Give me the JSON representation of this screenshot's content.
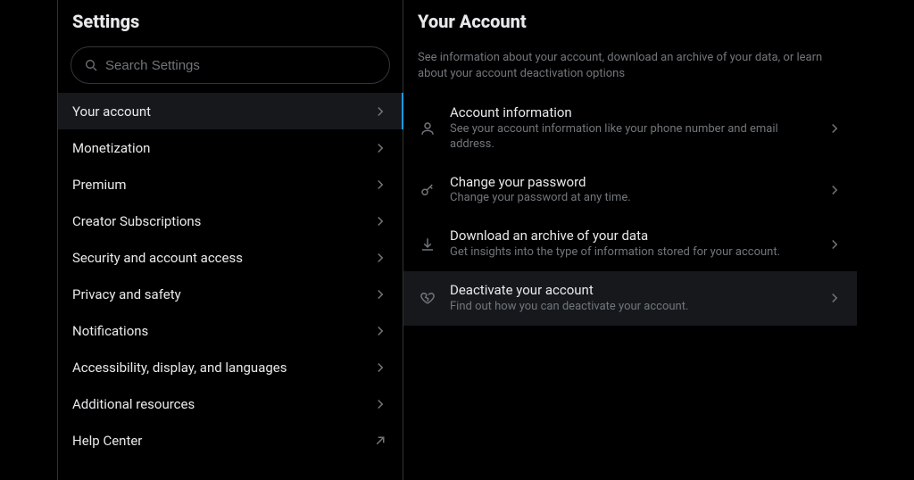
{
  "left": {
    "title": "Settings",
    "search_placeholder": "Search Settings",
    "items": [
      {
        "label": "Your account",
        "selected": true,
        "external": false
      },
      {
        "label": "Monetization",
        "selected": false,
        "external": false
      },
      {
        "label": "Premium",
        "selected": false,
        "external": false
      },
      {
        "label": "Creator Subscriptions",
        "selected": false,
        "external": false
      },
      {
        "label": "Security and account access",
        "selected": false,
        "external": false
      },
      {
        "label": "Privacy and safety",
        "selected": false,
        "external": false
      },
      {
        "label": "Notifications",
        "selected": false,
        "external": false
      },
      {
        "label": "Accessibility, display, and languages",
        "selected": false,
        "external": false
      },
      {
        "label": "Additional resources",
        "selected": false,
        "external": false
      },
      {
        "label": "Help Center",
        "selected": false,
        "external": true
      }
    ]
  },
  "right": {
    "title": "Your Account",
    "description": "See information about your account, download an archive of your data, or learn about your account deactivation options",
    "options": [
      {
        "icon": "user-icon",
        "title": "Account information",
        "subtitle": "See your account information like your phone number and email address.",
        "highlight": false
      },
      {
        "icon": "key-icon",
        "title": "Change your password",
        "subtitle": "Change your password at any time.",
        "highlight": false
      },
      {
        "icon": "download-icon",
        "title": "Download an archive of your data",
        "subtitle": "Get insights into the type of information stored for your account.",
        "highlight": false
      },
      {
        "icon": "heartbreak-icon",
        "title": "Deactivate your account",
        "subtitle": "Find out how you can deactivate your account.",
        "highlight": true
      }
    ]
  }
}
